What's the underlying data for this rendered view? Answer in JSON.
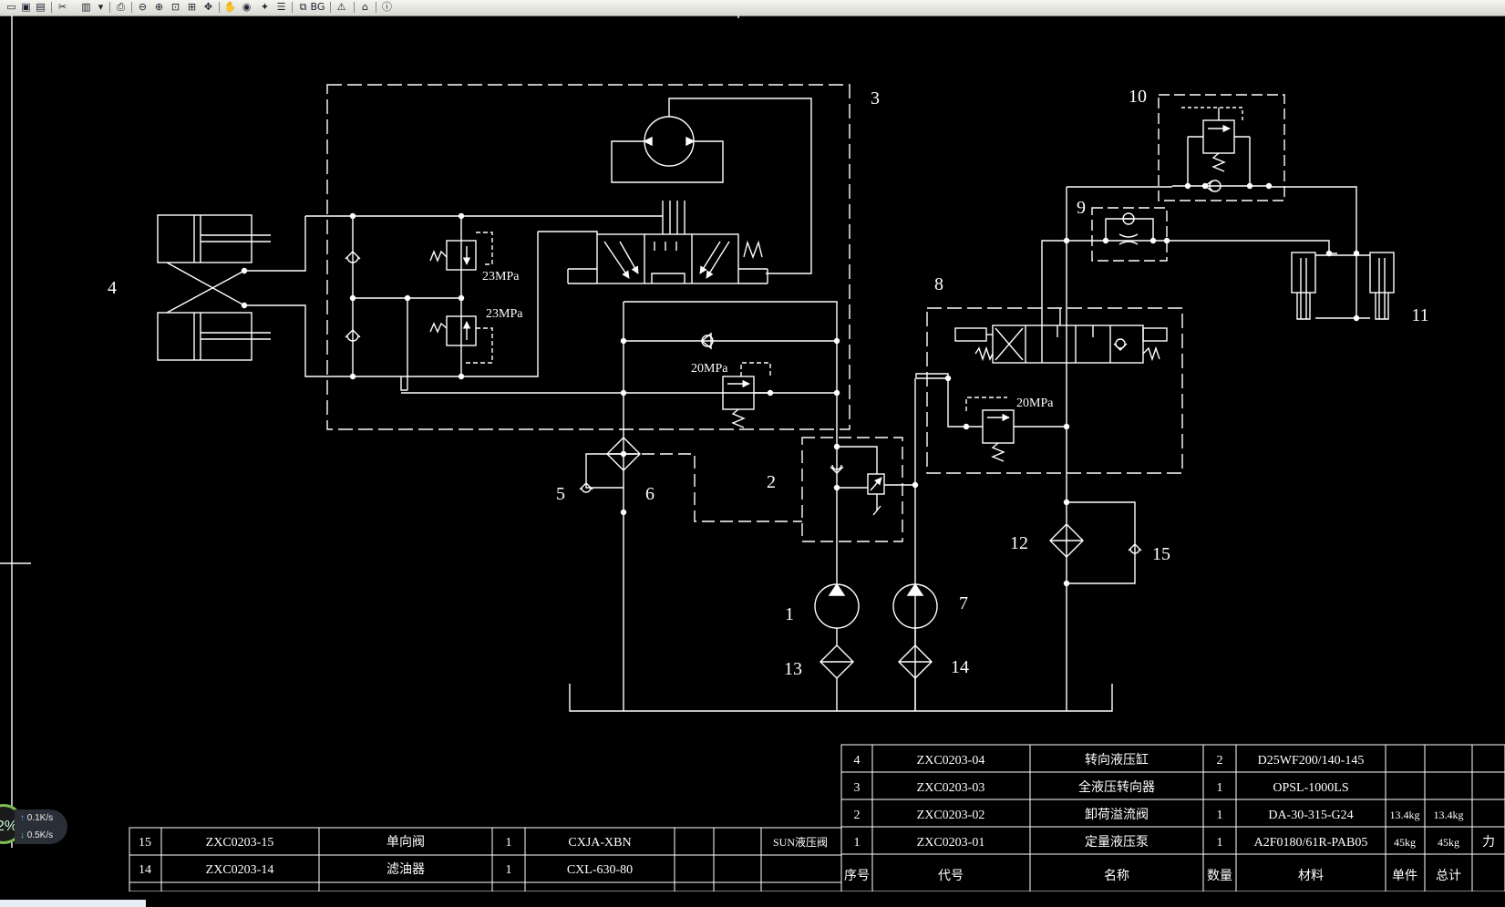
{
  "toolbar": {
    "icons": [
      "open-icon",
      "save-icon",
      "export-icon",
      "tools-icon",
      "layers-icon",
      "dropdown-icon",
      "print-icon",
      "zoom-out-icon",
      "zoom-in-icon",
      "zoom-window-icon",
      "zoom-extents-icon",
      "pan-icon",
      "pan-realtime-icon",
      "view-icon",
      "highlight-icon",
      "layer-list-icon",
      "copy-icon",
      "bg-icon",
      "warning-icon",
      "home-icon",
      "info-icon"
    ],
    "glyphs": [
      "▭",
      "▣",
      "▤",
      "✂",
      "▥",
      "▾",
      "⎙",
      "⊖",
      "⊕",
      "⊡",
      "⊞",
      "✥",
      "✋",
      "◉",
      "✦",
      "☰",
      "⧉",
      "BG",
      "⚠",
      "⌂",
      "ⓘ"
    ]
  },
  "colors": {
    "background": "#000000",
    "lines": "#ffffff",
    "toolbar": "#e6e6e0"
  },
  "diagram": {
    "callouts": [
      "1",
      "2",
      "3",
      "4",
      "5",
      "6",
      "7",
      "8",
      "9",
      "10",
      "11",
      "12",
      "13",
      "14",
      "15"
    ],
    "pressures": [
      "23MPa",
      "23MPa",
      "20MPa",
      "20MPa"
    ]
  },
  "bom_right": {
    "rows": [
      {
        "no": "4",
        "code": "ZXC0203-04",
        "name": "转向液压缸",
        "qty": "2",
        "material": "D25WF200/140-145",
        "unit": "",
        "total": ""
      },
      {
        "no": "3",
        "code": "ZXC0203-03",
        "name": "全液压转向器",
        "qty": "1",
        "material": "OPSL-1000LS",
        "unit": "",
        "total": ""
      },
      {
        "no": "2",
        "code": "ZXC0203-02",
        "name": "卸荷溢流阀",
        "qty": "1",
        "material": "DA-30-315-G24",
        "unit": "13.4kg",
        "total": "13.4kg"
      },
      {
        "no": "1",
        "code": "ZXC0203-01",
        "name": "定量液压泵",
        "qty": "1",
        "material": "A2F0180/61R-PAB05",
        "unit": "45kg",
        "total": "45kg",
        "extra": "力"
      }
    ],
    "headers": {
      "no": "序号",
      "code": "代号",
      "name": "名称",
      "qty": "数量",
      "material": "材料",
      "unit": "单件",
      "total": "总计"
    }
  },
  "bom_left": {
    "rows": [
      {
        "no": "15",
        "code": "ZXC0203-15",
        "name": "单向阀",
        "qty": "1",
        "material": "CXJA-XBN",
        "supplier": "SUN液压阀"
      },
      {
        "no": "14",
        "code": "ZXC0203-14",
        "name": "滤油器",
        "qty": "1",
        "material": "CXL-630-80",
        "supplier": ""
      }
    ]
  },
  "net_widget": {
    "percent": "2%",
    "up": "0.1K/s",
    "down": "0.5K/s"
  }
}
